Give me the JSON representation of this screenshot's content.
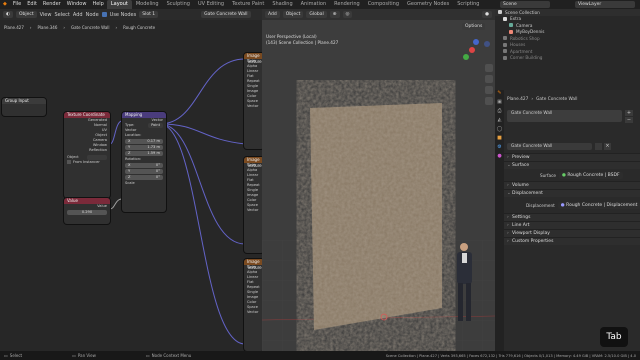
{
  "topbar": {
    "menus": [
      "File",
      "Edit",
      "Render",
      "Window",
      "Help"
    ],
    "workspaces": [
      "Layout",
      "Modeling",
      "Sculpting",
      "UV Editing",
      "Texture Paint",
      "Shading",
      "Animation",
      "Rendering",
      "Compositing",
      "Geometry Nodes",
      "Scripting"
    ],
    "scene": "Scene",
    "viewlayer": "ViewLayer"
  },
  "node_header": {
    "mode": "Object",
    "menus": [
      "View",
      "Select",
      "Add",
      "Node"
    ],
    "use_nodes": "Use Nodes",
    "slot": "Slot 1",
    "material": "Gate Concrete Wall"
  },
  "breadcrumb": [
    "Plane.427",
    "Plane.346",
    "Gate Concrete Wall",
    "Rough Concrete"
  ],
  "nodes": {
    "group_input": {
      "title": "Group Input"
    },
    "texcoord": {
      "title": "Texture Coordinate",
      "outputs": [
        "Generated",
        "Normal",
        "UV",
        "Object",
        "Camera",
        "Window",
        "Reflection"
      ],
      "object_label": "Object",
      "from_instancer": "From Instancer"
    },
    "mapping": {
      "title": "Mapping",
      "vector_out": "Vector",
      "type_label": "Type:",
      "type_value": "Point",
      "vector_in": "Vector",
      "location": "Location:",
      "loc": [
        [
          "X",
          "0.17 m"
        ],
        [
          "Y",
          "1.73 m"
        ],
        [
          "Z",
          "1.59 m"
        ]
      ],
      "rotation": "Rotation:",
      "rot": [
        [
          "X",
          "0°"
        ],
        [
          "Y",
          "0°"
        ],
        [
          "Z",
          "0°"
        ]
      ],
      "scale": "Scale"
    },
    "value": {
      "title": "Value",
      "out": "Value",
      "val": "0.290"
    },
    "img": {
      "title": "Image Texture",
      "rows": [
        "Color",
        "Alpha",
        "Linear",
        "Flat",
        "Repeat",
        "Single Image",
        "Color Space",
        "Alpha",
        "Vector"
      ]
    }
  },
  "viewport_header": {
    "add": "Add",
    "object": "Object",
    "orientation": "Global",
    "options": "Options"
  },
  "viewport": {
    "perspective": "User Perspective (Local)",
    "collection": "(143) Scene Collection | Plane.427",
    "overlay_key": "Tab"
  },
  "outliner": {
    "items": [
      "Scene Collection",
      "Extra",
      "Camera",
      "MyBoyDennis",
      "Robotics Shop",
      "Houses",
      "Apartment",
      "Corner Building"
    ]
  },
  "props": {
    "object": "Plane.427",
    "material": "Gate Concrete Wall",
    "slot_name": "Gate Concrete Wall",
    "mat_field": "Gate Concrete Wall",
    "panels": [
      "Preview",
      "Surface",
      "Volume",
      "Displacement",
      "Settings",
      "Line Art",
      "Viewport Display",
      "Custom Properties"
    ],
    "surface_label": "Surface",
    "surface_value": "Rough Concrete | BSDF",
    "disp_label": "Displacement",
    "disp_value": "Rough Concrete | Displacement"
  },
  "status": {
    "select": "Select",
    "pan": "Pan View",
    "context": "Node Context Menu",
    "stats": "Scene Collection | Plane.427 | Verts 393,665 | Faces 672,132 | Tris 779,616 | Objects 0/1,013 | Memory: 4.49 GiB | VRAM: 2.5/10.0 GiB | 4.0"
  },
  "colors": {
    "accent": "#4772b3",
    "node_link": "#6363c7",
    "value_head": "#7b2a3a",
    "mapping_head": "#4a3c7c",
    "texcoord_head": "#7b2a3a",
    "img_head": "#7a4a20"
  }
}
